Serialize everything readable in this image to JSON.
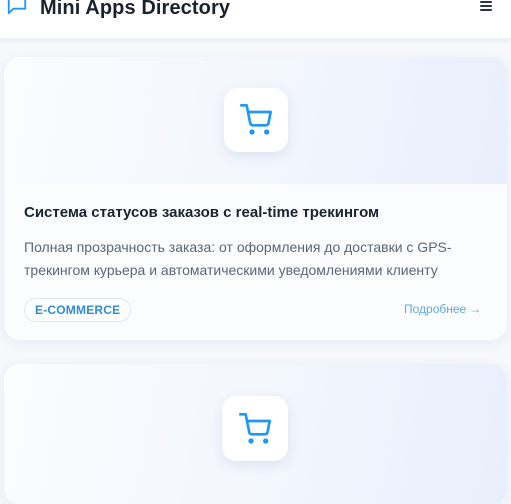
{
  "header": {
    "title": "Mini Apps Directory",
    "logo_icon": "chat-bubble-icon",
    "menu_icon": "hamburger-menu-icon"
  },
  "cards": [
    {
      "icon": "shopping-cart-icon",
      "title": "Система статусов заказов с real-time трекингом",
      "description": "Полная прозрачность заказа: от оформления до доставки с GPS-трекингом курьера и автоматическими уведомлениями клиенту",
      "tag": "E-COMMERCE",
      "link_label": "Подробнее",
      "link_arrow": "→"
    },
    {
      "icon": "shopping-cart-icon"
    }
  ],
  "colors": {
    "accent": "#2196f3",
    "tag_text": "#2f8bd6",
    "link": "#5fa8e4",
    "title": "#1a2230",
    "body_text": "#5c6675"
  }
}
